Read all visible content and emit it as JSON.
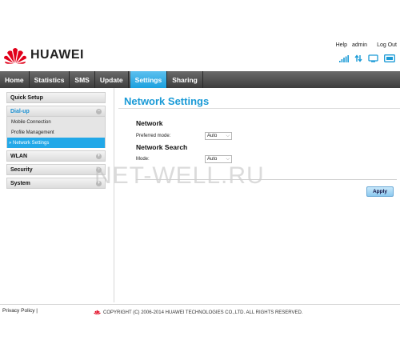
{
  "brand": {
    "name": "HUAWEI",
    "logo_color": "#e1001a"
  },
  "top_links": {
    "help": "Help",
    "user": "admin",
    "logout": "Log Out"
  },
  "status_icons": [
    "signal-strength-icon",
    "data-transfer-icon",
    "computer-connected-icon",
    "sms-envelope-icon"
  ],
  "nav": {
    "items": [
      {
        "label": "Home"
      },
      {
        "label": "Statistics"
      },
      {
        "label": "SMS"
      },
      {
        "label": "Update"
      },
      {
        "label": "Settings",
        "active": true
      },
      {
        "label": "Sharing"
      }
    ]
  },
  "sidebar": {
    "quick_setup": "Quick Setup",
    "dialup": "Dial-up",
    "dialup_items": [
      "Mobile Connection",
      "Profile Management",
      "» Network Settings"
    ],
    "wlan": "WLAN",
    "security": "Security",
    "system": "System"
  },
  "main": {
    "title": "Network Settings",
    "network_heading": "Network",
    "preferred_mode_label": "Preferred mode:",
    "preferred_mode_value": "Auto",
    "network_search_heading": "Network Search",
    "mode_label": "Mode:",
    "mode_value": "Auto",
    "apply_label": "Apply"
  },
  "watermark": "NET-WELL.RU",
  "footer": {
    "privacy": "Privacy Policy |",
    "copyright": "COPYRIGHT (C) 2006-2014 HUAWEI TECHNOLOGIES CO.,LTD. ALL RIGHTS RESERVED."
  },
  "colors": {
    "accent": "#1a9ad6",
    "nav_active": "#22a8e8",
    "nav_bar": "#4a4a4a"
  }
}
